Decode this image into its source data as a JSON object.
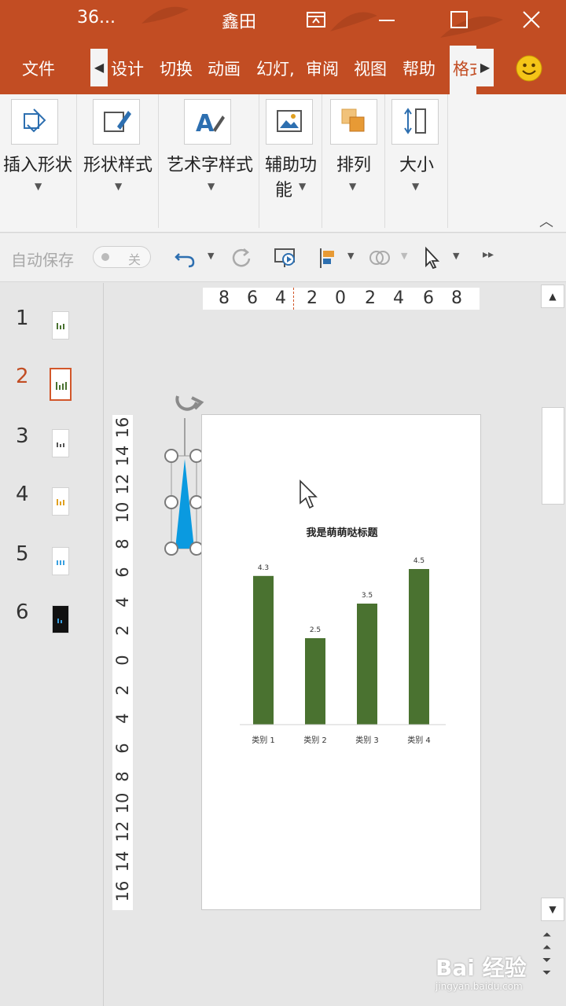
{
  "titlebar": {
    "doc_title": "36...",
    "user_name": "鑫田",
    "icons": [
      "ribbon-display-icon",
      "minimize-icon",
      "maximize-icon",
      "close-icon"
    ]
  },
  "tabs": [
    "文件",
    "设计",
    "切换",
    "动画",
    "幻灯,",
    "审阅",
    "视图",
    "帮助",
    "格式"
  ],
  "ribbon_groups": [
    {
      "label": "插入形状",
      "icon": "insert-shape-icon"
    },
    {
      "label": "形状样式",
      "icon": "shape-style-icon"
    },
    {
      "label": "艺术字样式",
      "icon": "wordart-style-icon"
    },
    {
      "label_line1": "辅助功",
      "label_line2": "能",
      "icon": "accessibility-icon"
    },
    {
      "label": "排列",
      "icon": "arrange-icon"
    },
    {
      "label": "大小",
      "icon": "size-icon"
    }
  ],
  "qat": {
    "autosave_label": "自动保存",
    "autosave_state": "关",
    "icons": [
      "undo-icon",
      "redo-icon",
      "start-slideshow-icon",
      "format-painter-icon",
      "merge-shapes-icon",
      "select-icon",
      "more-icon"
    ]
  },
  "slides": [
    {
      "num": "1"
    },
    {
      "num": "2"
    },
    {
      "num": "3"
    },
    {
      "num": "4"
    },
    {
      "num": "5"
    },
    {
      "num": "6"
    }
  ],
  "active_slide": "2",
  "hruler_labels": [
    "8",
    "6",
    "4",
    "2",
    "0",
    "2",
    "4",
    "6",
    "8"
  ],
  "vruler_labels": [
    "16",
    "14",
    "12",
    "10",
    "8",
    "6",
    "4",
    "2",
    "0",
    "2",
    "4",
    "6",
    "8",
    "10",
    "12",
    "14",
    "16"
  ],
  "colors": {
    "accent": "#c24d23",
    "bar": "#4a7230",
    "shape": "#0a9ae0"
  },
  "chart_data": {
    "type": "bar",
    "title": "我是萌萌哒标题",
    "categories": [
      "类别 1",
      "类别 2",
      "类别 3",
      "类别 4"
    ],
    "values": [
      4.3,
      2.5,
      3.5,
      4.5
    ],
    "data_labels": [
      "4.3",
      "2.5",
      "3.5",
      "4.5"
    ],
    "ylim": [
      0,
      5
    ],
    "grid": false,
    "legend": "none"
  },
  "watermark": {
    "main": "Bai 经验",
    "sub": "jingyan.baidu.com"
  }
}
